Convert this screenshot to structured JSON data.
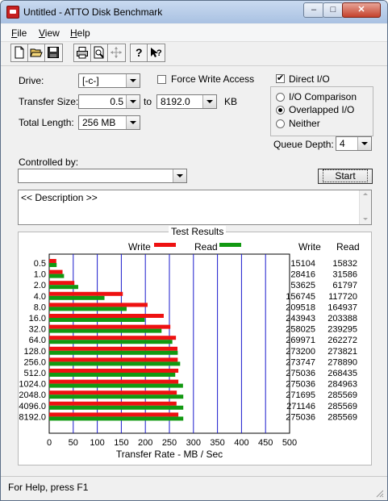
{
  "window": {
    "title": "Untitled - ATTO Disk Benchmark",
    "min_glyph": "–",
    "max_glyph": "□",
    "close_glyph": "✕"
  },
  "menu": [
    {
      "label": "File",
      "accel": "F",
      "rest": "ile"
    },
    {
      "label": "View",
      "accel": "V",
      "rest": "iew"
    },
    {
      "label": "Help",
      "accel": "H",
      "rest": "elp"
    }
  ],
  "toolbar": {
    "icons": [
      "new-file-icon",
      "open-folder-icon",
      "save-icon",
      "print-icon",
      "print-preview-icon",
      "move-icon",
      "context-help-icon",
      "what-is-this-icon"
    ]
  },
  "form": {
    "drive_label": "Drive:",
    "drive_value": "[-c-]",
    "force_write_label": "Force Write Access",
    "direct_io_label": "Direct I/O",
    "transfer_size_label": "Transfer Size:",
    "transfer_from": "0.5",
    "to_label": "to",
    "transfer_to": "8192.0",
    "kb_label": "KB",
    "total_length_label": "Total Length:",
    "total_length_value": "256 MB",
    "io_comparison_label": "I/O Comparison",
    "overlapped_io_label": "Overlapped I/O",
    "neither_label": "Neither",
    "queue_depth_label": "Queue Depth:",
    "queue_depth_value": "4",
    "controlled_by_label": "Controlled by:",
    "controlled_by_value": "",
    "start_label": "Start",
    "description": "<< Description >>"
  },
  "status": {
    "text": "For Help, press F1"
  },
  "chart_data": {
    "type": "bar",
    "title": "Test Results",
    "xlabel": "Transfer Rate - MB / Sec",
    "xlim": [
      0,
      500
    ],
    "xticks": [
      0,
      50,
      100,
      150,
      200,
      250,
      300,
      350,
      400,
      450,
      500
    ],
    "col_write_label": "Write",
    "col_read_label": "Read",
    "categories": [
      "0.5",
      "1.0",
      "2.0",
      "4.0",
      "8.0",
      "16.0",
      "32.0",
      "64.0",
      "128.0",
      "256.0",
      "512.0",
      "1024.0",
      "2048.0",
      "4096.0",
      "8192.0"
    ],
    "series": [
      {
        "name": "Write",
        "color": "#ee1111",
        "values": [
          15104,
          28416,
          53625,
          156745,
          209518,
          243943,
          258025,
          269971,
          273200,
          273747,
          275036,
          275036,
          271695,
          271146,
          275036
        ]
      },
      {
        "name": "Read",
        "color": "#119911",
        "values": [
          15832,
          31586,
          61797,
          117720,
          164937,
          203388,
          239295,
          262272,
          273821,
          278890,
          268435,
          284963,
          285569,
          285569,
          285569
        ]
      }
    ]
  }
}
